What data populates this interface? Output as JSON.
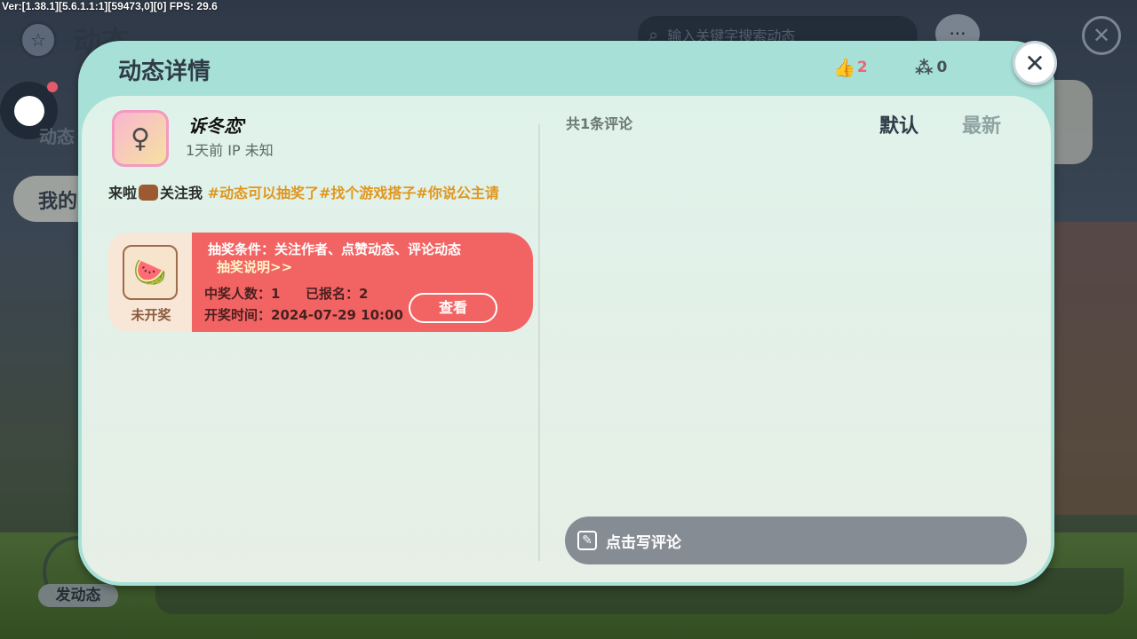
{
  "version": "Ver:[1.38.1][5.6.1.1:1][59473,0][0] FPS: 29.6",
  "background": {
    "page_title": "动态",
    "side_label": "动态",
    "side_button": "我的",
    "search_placeholder": "输入关键字搜索动态",
    "post_button_label": "发动态",
    "icons": [
      "star-icon",
      "search-icon",
      "chat-icon",
      "close-icon"
    ]
  },
  "modal": {
    "title": "动态详情",
    "like_count": "2",
    "share_count": "0",
    "close_icon": "close-icon"
  },
  "post": {
    "username": "诉冬恋'",
    "meta": "1天前 IP 未知",
    "text_prefix": "来啦",
    "text_follow": "关注我",
    "hashtags": "#动态可以抽奖了#找个游戏搭子#你说公主请"
  },
  "lottery": {
    "status": "未开奖",
    "condition": "抽奖条件：关注作者、点赞动态、评论动态",
    "link": "抽奖说明>>",
    "winners": "中奖人数：1",
    "signed_up": "已报名：2",
    "draw_time": "开奖时间：2024-07-29 10:00",
    "view_button": "查看"
  },
  "comments": {
    "count_label": "共1条评论",
    "sort_default": "默认",
    "sort_new": "最新",
    "input_placeholder": "点击写评论"
  },
  "colors": {
    "modal_bg": "#a7e0d6",
    "content_bg": "#dff2ea",
    "accent_pink": "#e86678",
    "hashtag": "#e0961d",
    "lottery_red": "#f26463",
    "comment_input": "#858c94"
  }
}
